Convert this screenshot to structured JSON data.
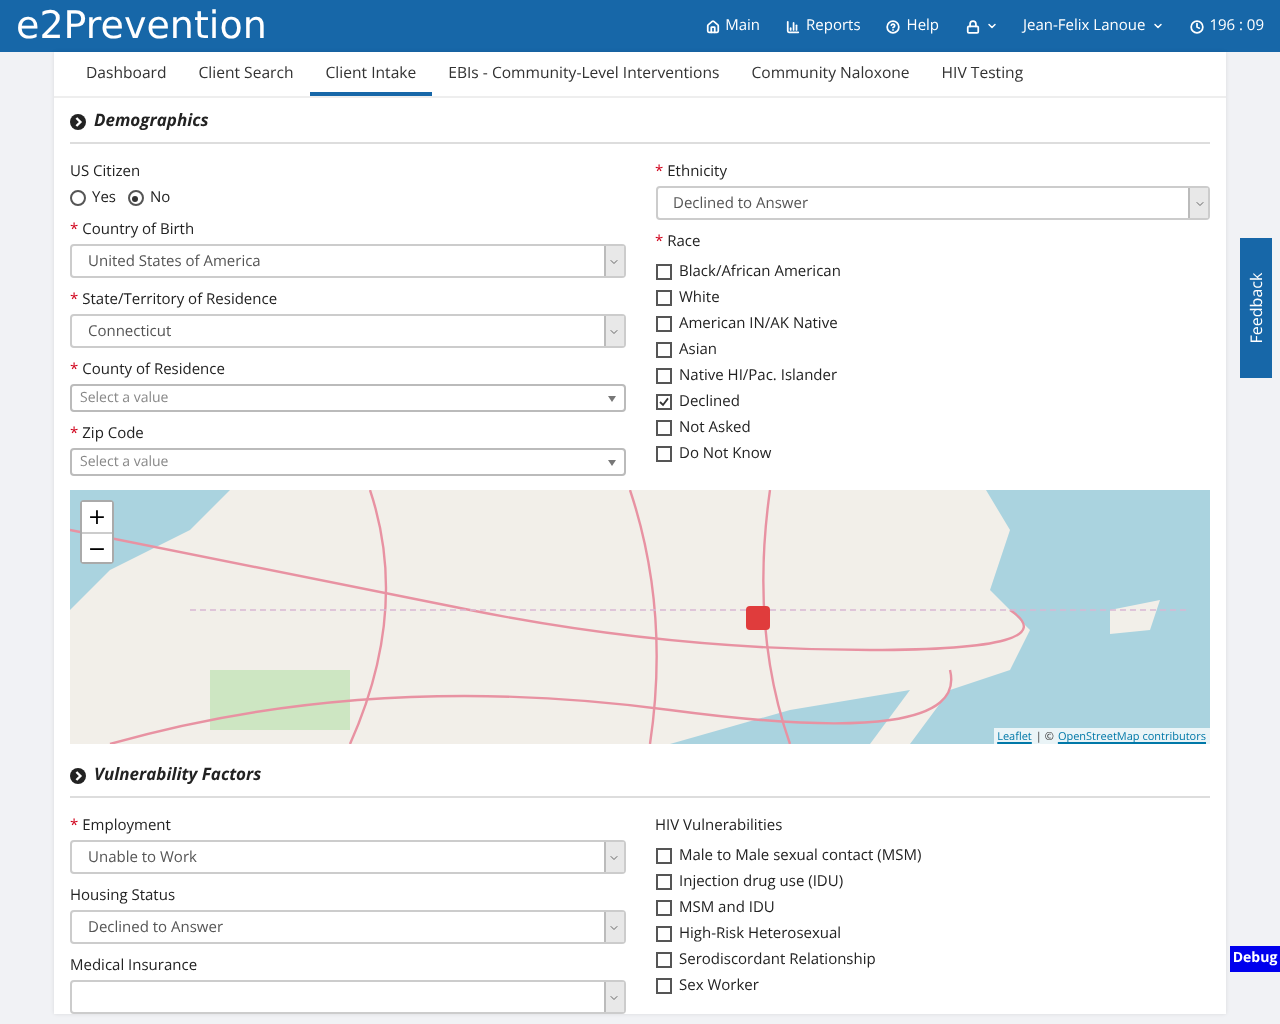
{
  "navbar": {
    "brand": "e2Prevention",
    "items": [
      {
        "kind": "link",
        "label": "Main"
      },
      {
        "kind": "link",
        "label": "Reports"
      },
      {
        "kind": "link",
        "label": "Help"
      },
      {
        "kind": "dropdown"
      },
      {
        "kind": "dropdown",
        "label": "Jean-Felix Lanoue"
      },
      {
        "kind": "link",
        "label": "196 : 09"
      }
    ]
  },
  "required_mark": "*",
  "tabs": [
    {
      "label": "Dashboard",
      "selected": false
    },
    {
      "label": "Client Search",
      "selected": false
    },
    {
      "label": "Client Intake",
      "selected": true
    },
    {
      "label": "EBIs - Community-Level Interventions",
      "selected": false
    },
    {
      "label": "Community Naloxone",
      "selected": false
    },
    {
      "label": "HIV Testing",
      "selected": false
    }
  ],
  "sections": [
    {
      "title": "Demographics",
      "left": [
        {
          "kind": "radio",
          "label": "US Citizen",
          "required": false,
          "options": [
            {
              "label": "Yes",
              "selected": false
            },
            {
              "label": "No",
              "selected": true
            }
          ]
        },
        {
          "kind": "select",
          "label": "Country of Birth",
          "required": true,
          "value": "United States of America"
        },
        {
          "kind": "select",
          "label": "State/Territory of Residence",
          "required": true,
          "value": "Connecticut"
        },
        {
          "kind": "combo",
          "label": "County of Residence",
          "required": true,
          "placeholder": "Select a value"
        },
        {
          "kind": "combo",
          "label": "Zip Code",
          "required": true,
          "placeholder": "Select a value"
        }
      ],
      "right": [
        {
          "kind": "select",
          "label": "Ethnicity",
          "required": true,
          "value": "Declined to Answer"
        },
        {
          "kind": "checklist",
          "label": "Race",
          "required": true,
          "items": [
            {
              "label": "Black/African American",
              "checked": false
            },
            {
              "label": "White",
              "checked": false
            },
            {
              "label": "American IN/AK Native",
              "checked": false
            },
            {
              "label": "Asian",
              "checked": false
            },
            {
              "label": "Native HI/Pac. Islander",
              "checked": false
            },
            {
              "label": "Declined",
              "checked": true
            },
            {
              "label": "Not Asked",
              "checked": false
            },
            {
              "label": "Do Not Know",
              "checked": false
            }
          ]
        }
      ],
      "map": {
        "zoom_in": "+",
        "zoom_out": "−",
        "attribution": [
          {
            "kind": "link",
            "text": "Leaflet"
          },
          {
            "kind": "text",
            "text": "| ©"
          },
          {
            "kind": "link",
            "text": "OpenStreetMap contributors"
          }
        ]
      }
    },
    {
      "title": "Vulnerability Factors",
      "left": [
        {
          "kind": "select",
          "label": "Employment",
          "required": true,
          "value": "Unable to Work"
        },
        {
          "kind": "select",
          "label": "Housing Status",
          "required": false,
          "value": "Declined to Answer"
        },
        {
          "kind": "select",
          "label": "Medical Insurance",
          "required": false
        }
      ],
      "right": [
        {
          "kind": "checklist",
          "label": "HIV Vulnerabilities",
          "required": false,
          "items": [
            {
              "label": "Male to Male sexual contact (MSM)",
              "checked": false
            },
            {
              "label": "Injection drug use (IDU)",
              "checked": false
            },
            {
              "label": "MSM and IDU",
              "checked": false
            },
            {
              "label": "High-Risk Heterosexual",
              "checked": false
            },
            {
              "label": "Serodiscordant Relationship",
              "checked": false
            },
            {
              "label": "Sex Worker",
              "checked": false
            }
          ]
        }
      ]
    }
  ],
  "feedback": "Feedback",
  "debug": "Debug"
}
